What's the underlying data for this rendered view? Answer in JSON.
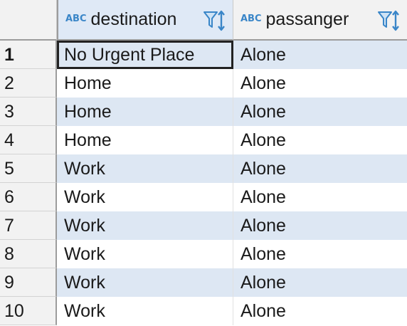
{
  "columns": [
    {
      "type_badge": "ABC",
      "label": "destination"
    },
    {
      "type_badge": "ABC",
      "label": "passanger"
    }
  ],
  "rows": [
    {
      "num": "1",
      "destination": "No Urgent Place",
      "passanger": "Alone"
    },
    {
      "num": "2",
      "destination": "Home",
      "passanger": "Alone"
    },
    {
      "num": "3",
      "destination": "Home",
      "passanger": "Alone"
    },
    {
      "num": "4",
      "destination": "Home",
      "passanger": "Alone"
    },
    {
      "num": "5",
      "destination": "Work",
      "passanger": "Alone"
    },
    {
      "num": "6",
      "destination": "Work",
      "passanger": "Alone"
    },
    {
      "num": "7",
      "destination": "Work",
      "passanger": "Alone"
    },
    {
      "num": "8",
      "destination": "Work",
      "passanger": "Alone"
    },
    {
      "num": "9",
      "destination": "Work",
      "passanger": "Alone"
    },
    {
      "num": "10",
      "destination": "Work",
      "passanger": "Alone"
    }
  ],
  "icons": {
    "type_badge": "abc-type-icon",
    "filter": "filter-icon",
    "sort": "sort-arrows-icon"
  },
  "colors": {
    "accent": "#3a86c8",
    "row_alt": "#dde7f3",
    "header": "#f2f2f2",
    "header_selected": "#dfe9f6"
  }
}
